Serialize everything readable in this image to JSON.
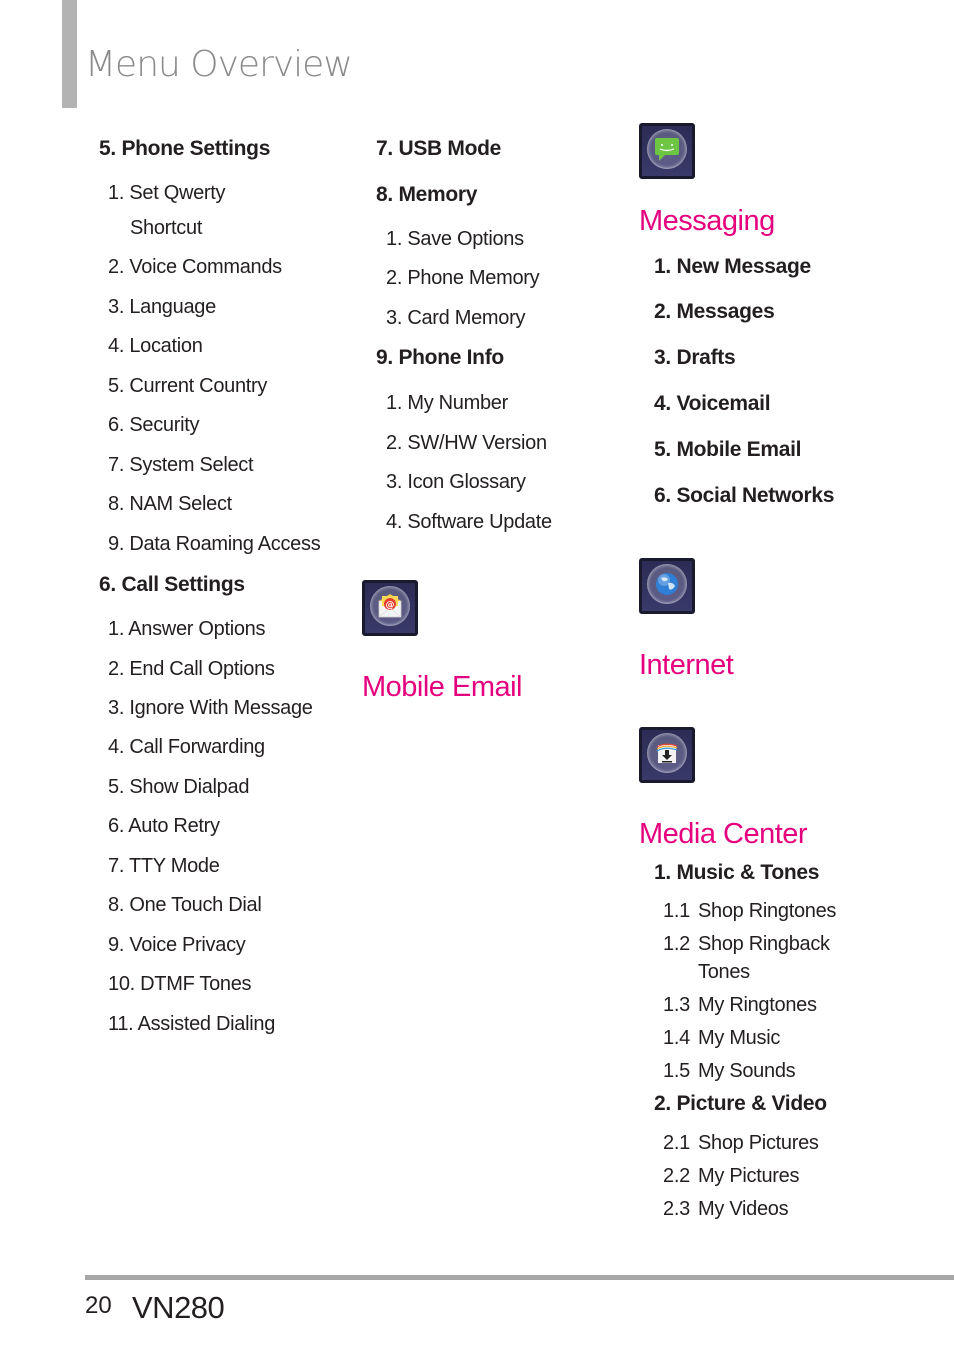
{
  "page": {
    "title": "Menu Overview",
    "page_number": "20",
    "model": "VN280"
  },
  "col1": {
    "phone_settings": {
      "heading": "5. Phone Settings",
      "items": [
        "1. Set Qwerty",
        "Shortcut",
        "2. Voice Commands",
        "3. Language",
        "4. Location",
        "5. Current Country",
        "6. Security",
        "7. System Select",
        "8. NAM Select",
        "9. Data Roaming Access"
      ]
    },
    "call_settings": {
      "heading": "6. Call Settings",
      "items": [
        "1. Answer Options",
        "2. End Call Options",
        "3. Ignore With Message",
        "4. Call Forwarding",
        "5. Show Dialpad",
        "6. Auto Retry",
        "7. TTY Mode",
        "8. One Touch Dial",
        "9. Voice Privacy",
        "10. DTMF Tones",
        "11. Assisted Dialing"
      ]
    }
  },
  "col2": {
    "usb_mode": {
      "heading": "7. USB Mode"
    },
    "memory": {
      "heading": "8. Memory",
      "items": [
        "1. Save Options",
        "2. Phone Memory",
        "3. Card Memory"
      ]
    },
    "phone_info": {
      "heading": "9. Phone Info",
      "items": [
        "1. My Number",
        "2. SW/HW Version",
        "3. Icon Glossary",
        "4. Software Update"
      ]
    },
    "mobile_email": {
      "icon": "email-envelope-icon",
      "title": "Mobile Email"
    }
  },
  "col3": {
    "messaging": {
      "icon": "chat-bubble-icon",
      "title": "Messaging",
      "items": [
        "1. New Message",
        "2. Messages",
        "3. Drafts",
        "4. Voicemail",
        "5. Mobile Email",
        "6. Social Networks"
      ]
    },
    "internet": {
      "icon": "globe-icon",
      "title": "Internet"
    },
    "media_center": {
      "icon": "download-arrow-icon",
      "title": "Media Center",
      "music_tones": {
        "heading": "1. Music & Tones",
        "items": [
          {
            "num": "1.1",
            "label": "Shop Ringtones"
          },
          {
            "num": "1.2",
            "label": "Shop Ringback"
          },
          {
            "num": "",
            "label": "Tones"
          },
          {
            "num": "1.3",
            "label": "My Ringtones"
          },
          {
            "num": "1.4",
            "label": "My Music"
          },
          {
            "num": "1.5",
            "label": "My Sounds"
          }
        ]
      },
      "picture_video": {
        "heading": "2. Picture & Video",
        "items": [
          {
            "num": "2.1",
            "label": "Shop Pictures"
          },
          {
            "num": "2.2",
            "label": "My Pictures"
          },
          {
            "num": "2.3",
            "label": "My Videos"
          }
        ]
      }
    }
  },
  "colors": {
    "accent": "#e5007e",
    "text": "#231f20",
    "title_gray": "#8a8a8a",
    "rule_gray": "#a7a7a7"
  }
}
